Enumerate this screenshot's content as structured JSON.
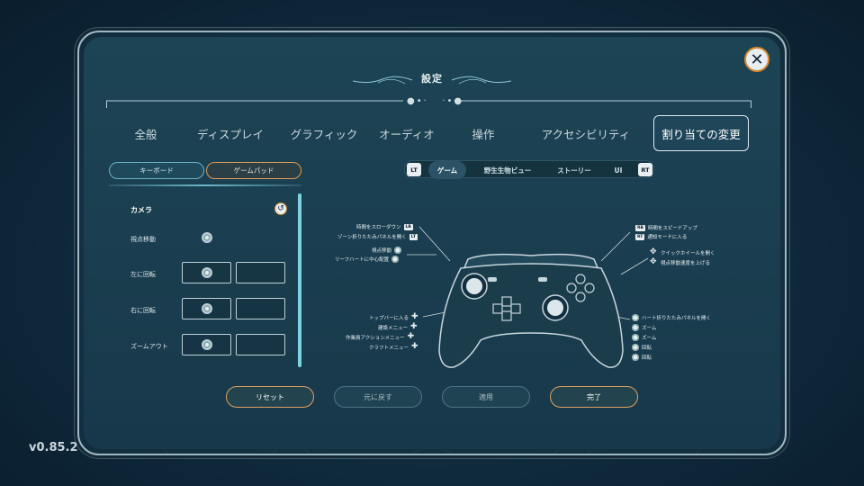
{
  "version": "v0.85.2",
  "title": "設定",
  "tabs": [
    "全般",
    "ディスプレイ",
    "グラフィック",
    "オーディオ",
    "操作",
    "アクセシビリティ",
    "割り当ての変更"
  ],
  "active_tab": "割り当ての変更",
  "device_toggle": {
    "keyboard": "キーボード",
    "gamepad": "ゲームパッド",
    "active": "ゲームパッド"
  },
  "section": {
    "title": "カメラ"
  },
  "bindings": [
    {
      "label": "視点移動"
    },
    {
      "label": "左に回転"
    },
    {
      "label": "右に回転"
    },
    {
      "label": "ズームアウト"
    }
  ],
  "mode_bar": {
    "left_key": "LT",
    "right_key": "RT",
    "modes": [
      "ゲーム",
      "野生生物ビュー",
      "ストーリー",
      "UI"
    ],
    "active": "ゲーム"
  },
  "annotations_left": [
    {
      "text": "時間をスローダウン",
      "icon": "LB"
    },
    {
      "text": "ゾーン折りたたみパネルを開く",
      "icon": "LT"
    },
    {
      "text": "視点移動",
      "icon": "stick"
    },
    {
      "text": "リーフハートに中心配置",
      "icon": "stick"
    },
    {
      "text": "トップバーに入る",
      "icon": "dpad"
    },
    {
      "text": "建設メニュー",
      "icon": "dpad"
    },
    {
      "text": "作業員アクションメニュー",
      "icon": "dpad"
    },
    {
      "text": "クラフトメニュー",
      "icon": "dpad"
    }
  ],
  "annotations_right": [
    {
      "text": "時間をスピードアップ",
      "icon": "RB"
    },
    {
      "text": "通知モードに入る",
      "icon": "RT"
    },
    {
      "text": "クイックホイールを開く",
      "icon": "face"
    },
    {
      "text": "視点移動速度を上げる",
      "icon": "face"
    },
    {
      "text": "ハート折りたたみパネルを開く",
      "icon": "stick"
    },
    {
      "text": "ズーム",
      "icon": "stick"
    },
    {
      "text": "ズーム",
      "icon": "stick"
    },
    {
      "text": "回転",
      "icon": "stick"
    },
    {
      "text": "回転",
      "icon": "stick"
    }
  ],
  "footer_buttons": {
    "reset": "リセット",
    "undo": "元に戻す",
    "apply": "適用",
    "done": "完了"
  },
  "colors": {
    "accent_orange": "#e0a060",
    "accent_cyan": "#7fd0e0",
    "panel_bg": "#1b3f50"
  }
}
